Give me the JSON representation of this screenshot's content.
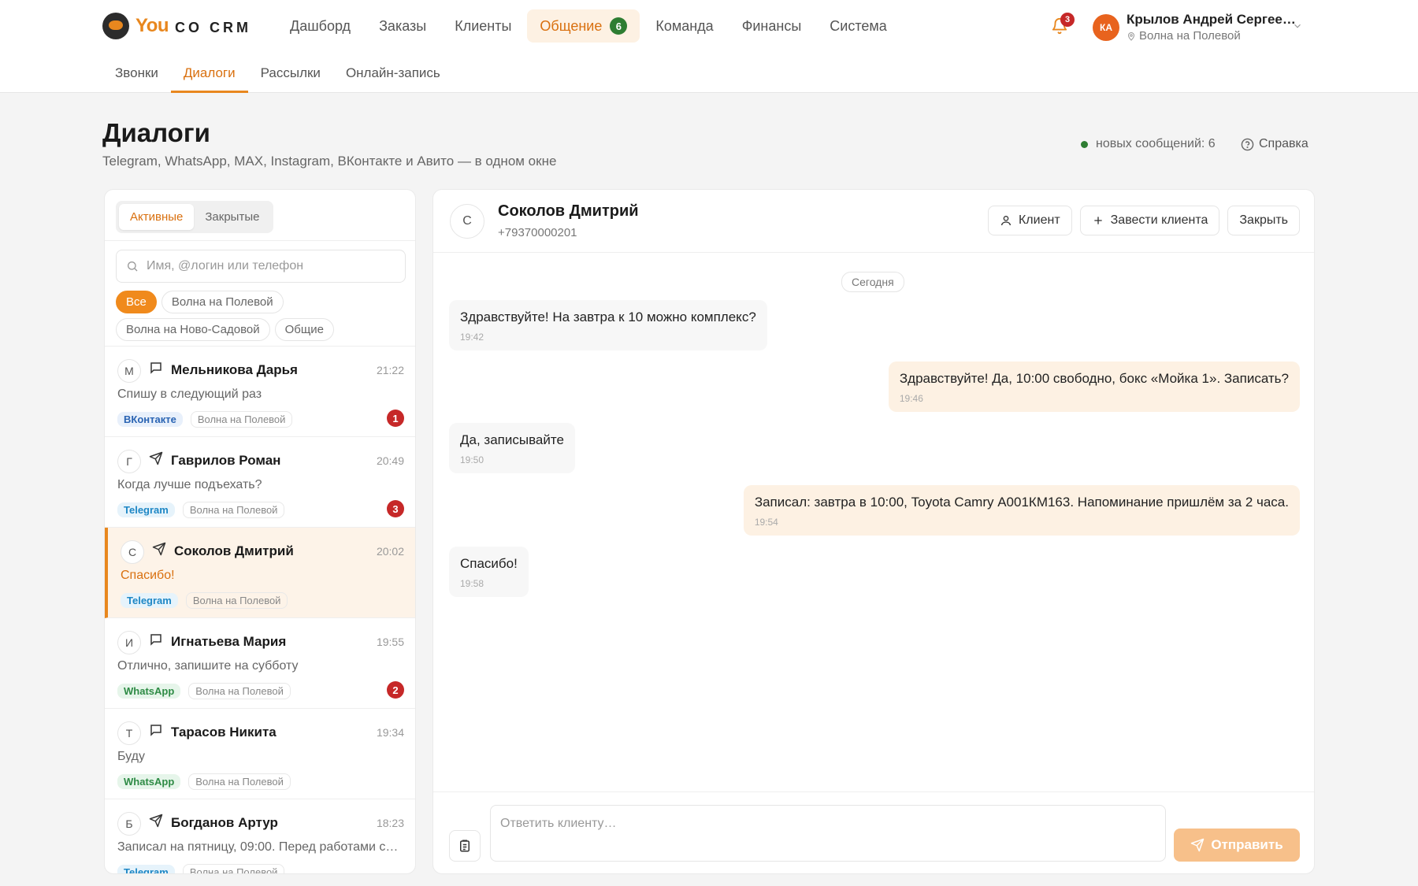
{
  "brand": {
    "you": "You",
    "crm": "CO CRM",
    "accent": "#e8871e"
  },
  "topnav": [
    {
      "label": "Дашборд"
    },
    {
      "label": "Заказы"
    },
    {
      "label": "Клиенты"
    },
    {
      "label": "Общение",
      "badge": "6",
      "active": true
    },
    {
      "label": "Команда"
    },
    {
      "label": "Финансы"
    },
    {
      "label": "Система"
    }
  ],
  "notifications": {
    "count": "3",
    "icon": "bell-icon"
  },
  "user": {
    "initials": "КА",
    "name": "Крылов Андрей Сергее…",
    "location": "Волна на Полевой"
  },
  "subnav": [
    {
      "label": "Звонки"
    },
    {
      "label": "Диалоги",
      "active": true
    },
    {
      "label": "Рассылки"
    },
    {
      "label": "Онлайн-запись"
    }
  ],
  "page": {
    "title": "Диалоги",
    "subtitle": "Telegram, WhatsApp, MAX, Instagram, ВКонтакте и Авито — в одном окне",
    "new_messages": "новых сообщений: 6",
    "help": "Справка"
  },
  "filters": {
    "segments": [
      "Активные",
      "Закрытые"
    ],
    "search_placeholder": "Имя, @логин или телефон",
    "chips": [
      "Все",
      "Волна на Полевой",
      "Волна на Ново-Садовой",
      "Общие"
    ]
  },
  "conversations": [
    {
      "initial": "М",
      "channel_icon": "chat-bubble-icon",
      "name": "Мельникова Дарья",
      "time": "21:22",
      "message": "Спишу в следующий раз",
      "channel": "ВКонтакте",
      "location": "Волна на Полевой",
      "unread": "1"
    },
    {
      "initial": "Г",
      "channel_icon": "telegram-icon",
      "name": "Гаврилов Роман",
      "time": "20:49",
      "message": "Когда лучше подъехать?",
      "channel": "Telegram",
      "location": "Волна на Полевой",
      "unread": "3"
    },
    {
      "initial": "С",
      "channel_icon": "telegram-icon",
      "name": "Соколов Дмитрий",
      "time": "20:02",
      "message": "Спасибо!",
      "channel": "Telegram",
      "location": "Волна на Полевой",
      "unread": ""
    },
    {
      "initial": "И",
      "channel_icon": "chat-bubble-icon",
      "name": "Игнатьева Мария",
      "time": "19:55",
      "message": "Отлично, запишите на субботу",
      "channel": "WhatsApp",
      "location": "Волна на Полевой",
      "unread": "2"
    },
    {
      "initial": "Т",
      "channel_icon": "chat-bubble-icon",
      "name": "Тарасов Никита",
      "time": "19:34",
      "message": "Буду",
      "channel": "WhatsApp",
      "location": "Волна на Полевой",
      "unread": ""
    },
    {
      "initial": "Б",
      "channel_icon": "telegram-icon",
      "name": "Богданов Артур",
      "time": "18:23",
      "message": "Записал на пятницу, 09:00. Перед работами сд…",
      "channel": "Telegram",
      "location": "Волна на Полевой",
      "unread": ""
    }
  ],
  "chat": {
    "initial": "С",
    "name": "Соколов Дмитрий",
    "phone": "+79370000201",
    "actions": {
      "client": "Клиент",
      "create_client": "Завести клиента",
      "close": "Закрыть"
    },
    "day": "Сегодня",
    "messages": [
      {
        "dir": "in",
        "text": "Здравствуйте! На завтра к 10 можно комплекс?",
        "time": "19:42"
      },
      {
        "dir": "out",
        "text": "Здравствуйте! Да, 10:00 свободно, бокс «Мойка 1». Записать?",
        "time": "19:46"
      },
      {
        "dir": "in",
        "text": "Да, записывайте",
        "time": "19:50"
      },
      {
        "dir": "out",
        "text": "Записал: завтра в 10:00, Toyota Camry А001КМ163. Напоминание пришлём за 2 часа.",
        "time": "19:54"
      },
      {
        "dir": "in",
        "text": "Спасибо!",
        "time": "19:58"
      }
    ],
    "reply_placeholder": "Ответить клиенту…",
    "send_label": "Отправить"
  }
}
